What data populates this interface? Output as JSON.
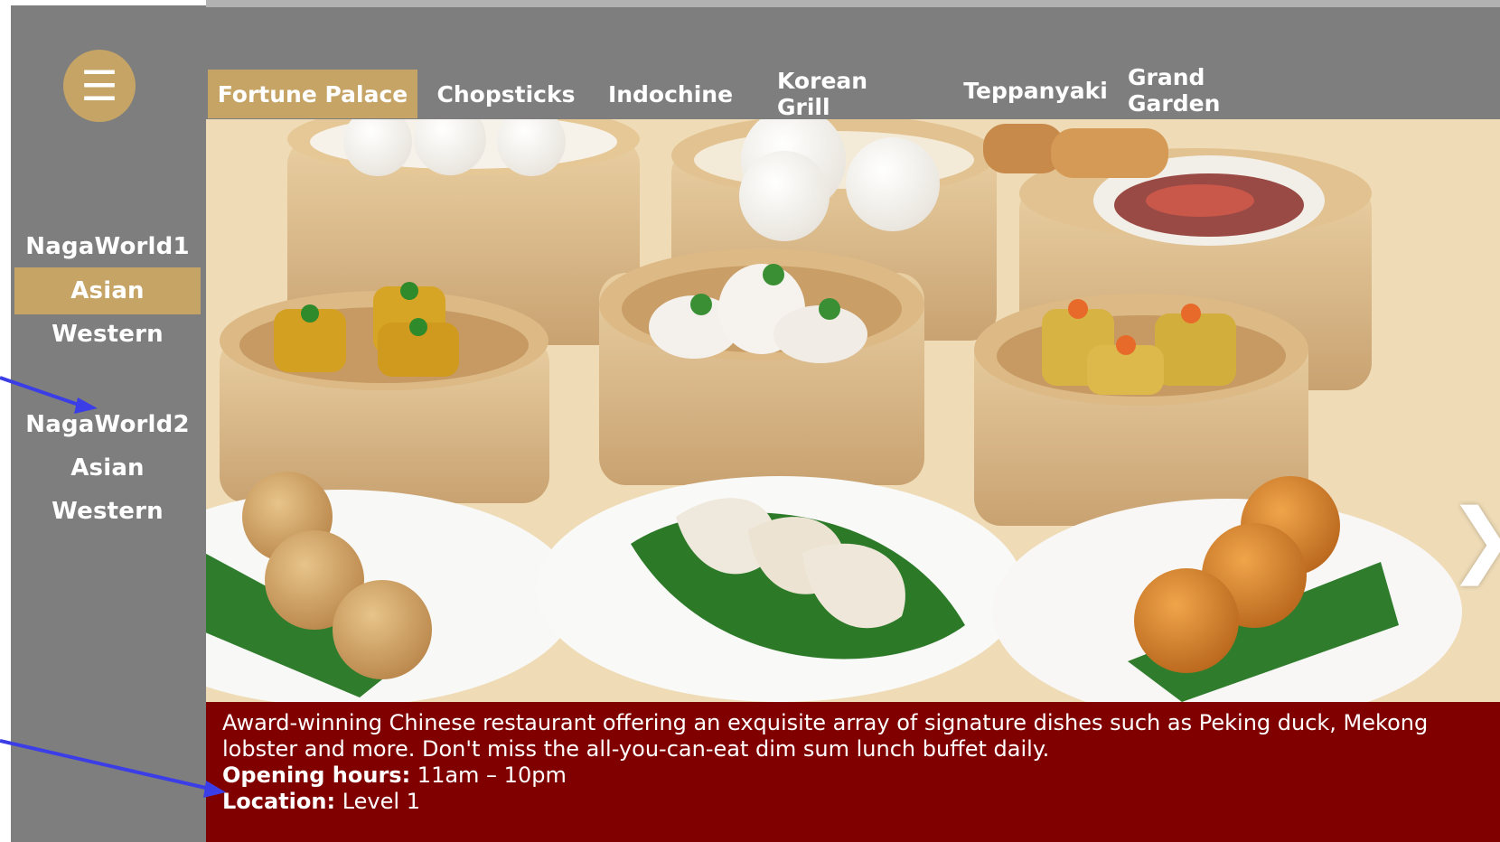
{
  "colors": {
    "frame_gray": "#7e7e7e",
    "gold": "#c5a466",
    "info_red": "#800000",
    "annotation_arrow": "#3b3ee6"
  },
  "sidebar": {
    "menu_icon": "hamburger-menu-icon",
    "groups": [
      {
        "heading": "NagaWorld1",
        "items": [
          {
            "label": "Asian",
            "active": true
          },
          {
            "label": "Western",
            "active": false
          }
        ]
      },
      {
        "heading": "NagaWorld2",
        "items": [
          {
            "label": "Asian",
            "active": false
          },
          {
            "label": "Western",
            "active": false
          }
        ]
      }
    ]
  },
  "tabs": [
    {
      "label": "Fortune Palace",
      "active": true
    },
    {
      "label": "Chopsticks",
      "active": false
    },
    {
      "label": "Indochine",
      "active": false
    },
    {
      "label": "Korean Grill",
      "active": false
    },
    {
      "label": "Teppanyaki",
      "active": false
    },
    {
      "label": "Grand Garden",
      "active": false
    }
  ],
  "hero": {
    "next_icon": "chevron-right-icon",
    "next_glyph": "❯"
  },
  "info": {
    "description": "Award-winning Chinese restaurant offering an exquisite array of signature dishes such as Peking duck, Mekong lobster and more. Don't miss the all-you-can-eat dim sum lunch buffet daily.",
    "hours_label": "Opening hours:",
    "hours_value": " 11am – 10pm",
    "location_label": "Location:",
    "location_value": " Level 1"
  }
}
